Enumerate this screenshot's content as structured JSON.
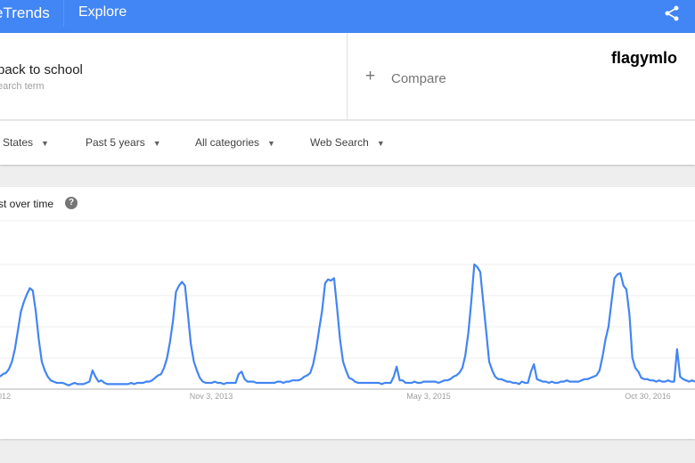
{
  "header": {
    "logo": "eTrends",
    "nav": "Explore",
    "share_icon": "share-icon",
    "color": "#4285f4"
  },
  "search": {
    "term": "back to school",
    "term_sub": "earch term",
    "compare_label": "Compare"
  },
  "brand": "flagymlo",
  "filters": [
    {
      "label": "l States"
    },
    {
      "label": "Past 5 years"
    },
    {
      "label": "All categories"
    },
    {
      "label": "Web Search"
    }
  ],
  "chart_card": {
    "title": "st over time",
    "help": "?"
  },
  "chart_data": {
    "type": "line",
    "title": "st over time",
    "x_tick_labels": [
      "2012",
      "Nov 3, 2013",
      "May 3, 2015",
      "Oct 30, 2016"
    ],
    "ylim": [
      0,
      100
    ],
    "grid": true,
    "series": [
      {
        "color": "#4285f4",
        "values": [
          10,
          12,
          13,
          16,
          22,
          32,
          47,
          62,
          70,
          76,
          81,
          79,
          62,
          40,
          22,
          15,
          10,
          7,
          6,
          5,
          5,
          5,
          4,
          3,
          4,
          5,
          4,
          4,
          4,
          5,
          6,
          15,
          10,
          6,
          7,
          5,
          4,
          4,
          4,
          4,
          4,
          4,
          4,
          4,
          5,
          4,
          5,
          5,
          5,
          6,
          6,
          7,
          9,
          11,
          12,
          17,
          25,
          38,
          55,
          78,
          83,
          86,
          83,
          60,
          36,
          22,
          15,
          9,
          6,
          5,
          5,
          5,
          6,
          5,
          5,
          4,
          5,
          5,
          5,
          5,
          12,
          14,
          8,
          6,
          6,
          6,
          5,
          5,
          5,
          5,
          5,
          5,
          5,
          6,
          6,
          5,
          6,
          6,
          7,
          7,
          7,
          8,
          10,
          11,
          13,
          20,
          32,
          48,
          63,
          85,
          88,
          87,
          89,
          65,
          40,
          22,
          15,
          9,
          8,
          6,
          5,
          5,
          5,
          5,
          5,
          5,
          5,
          5,
          4,
          5,
          5,
          5,
          10,
          18,
          7,
          7,
          5,
          5,
          5,
          6,
          5,
          5,
          6,
          6,
          6,
          6,
          6,
          5,
          6,
          7,
          7,
          8,
          10,
          11,
          13,
          17,
          27,
          45,
          70,
          100,
          98,
          94,
          70,
          46,
          22,
          15,
          10,
          8,
          8,
          7,
          6,
          6,
          5,
          5,
          4,
          6,
          5,
          5,
          14,
          20,
          8,
          7,
          6,
          6,
          5,
          6,
          5,
          5,
          6,
          6,
          7,
          6,
          6,
          6,
          6,
          7,
          8,
          8,
          9,
          10,
          11,
          15,
          26,
          40,
          50,
          70,
          89,
          92,
          93,
          83,
          80,
          60,
          25,
          17,
          14,
          9,
          8,
          8,
          7,
          7,
          6,
          7,
          6,
          6,
          7,
          6,
          6,
          32,
          10,
          8,
          7,
          6,
          7,
          6
        ]
      }
    ]
  }
}
